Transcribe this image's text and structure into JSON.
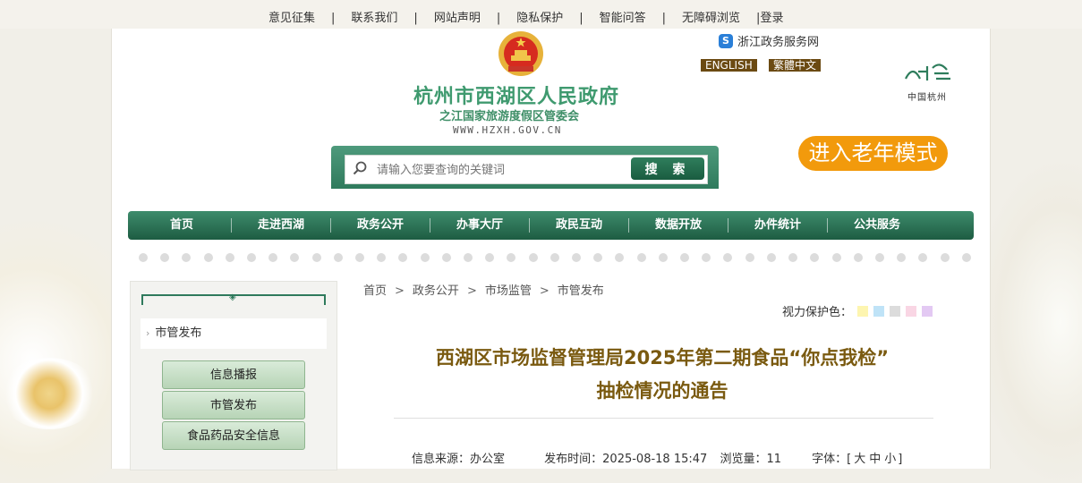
{
  "topbar": {
    "links": [
      "意见征集",
      "联系我们",
      "网站声明",
      "隐私保护",
      "智能问答",
      "无障碍浏览"
    ],
    "separator": "|",
    "login": "登录"
  },
  "header": {
    "site_name": "杭州市西湖区人民政府",
    "site_sub": "之江国家旅游度假区管委会",
    "site_url": "WWW.HZXH.GOV.CN",
    "zj_link": "浙江政务服务网",
    "lang_en": "ENGLISH",
    "lang_tc": "繁體中文",
    "hz_logo_text": "中国杭州"
  },
  "search": {
    "placeholder": "请输入您要查询的关键词",
    "button": "搜 索"
  },
  "elder_mode": "进入老年模式",
  "nav": [
    "首页",
    "走进西湖",
    "政务公开",
    "办事大厅",
    "政民互动",
    "数据开放",
    "办件统计",
    "公共服务"
  ],
  "sidebar": {
    "current": "市管发布",
    "items": [
      "信息播报",
      "市管发布",
      "食品药品安全信息"
    ]
  },
  "breadcrumb": {
    "items": [
      "首页",
      "政务公开",
      "市场监管",
      "市管发布"
    ],
    "sep": ">"
  },
  "eye_protect": {
    "label": "视力保护色：",
    "colors": [
      "#fdf5b0",
      "#bfe3f7",
      "#dcdcdc",
      "#f9d6e4",
      "#e3c9f3"
    ]
  },
  "article": {
    "title_line1": "西湖区市场监督管理局2025年第二期食品“你点我检”",
    "title_line2": "抽检情况的通告",
    "source": "信息来源：办公室",
    "date": "发布时间：2025-08-18 15:47",
    "views": "浏览量：11",
    "font_label": "字体：[",
    "font_large": "大",
    "font_mid": "中",
    "font_small": "小",
    "font_end": "]"
  },
  "colors": {
    "nav_green": "#2f7a5c",
    "title_brown": "#7a5a10",
    "elder_orange": "#f29a0c"
  }
}
